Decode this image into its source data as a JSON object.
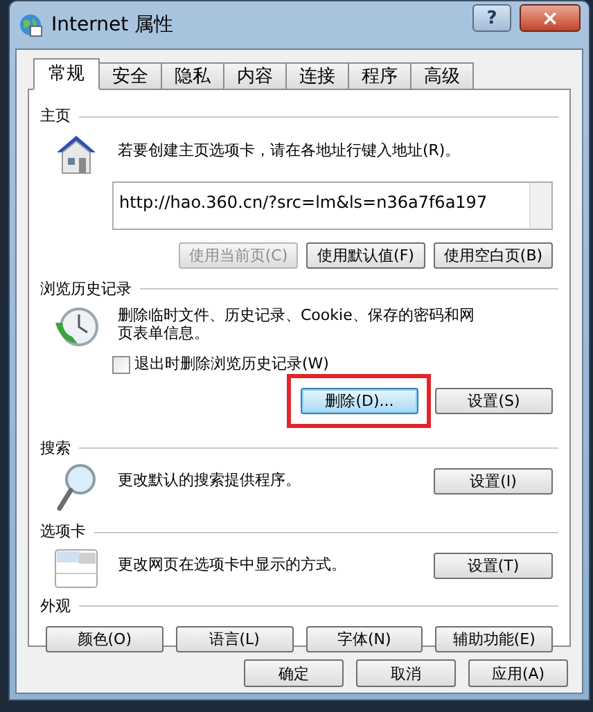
{
  "window": {
    "title": "Internet 属性",
    "help": "?",
    "close": "×"
  },
  "tabs": [
    {
      "label": "常规",
      "selected": true
    },
    {
      "label": "安全",
      "selected": false
    },
    {
      "label": "隐私",
      "selected": false
    },
    {
      "label": "内容",
      "selected": false
    },
    {
      "label": "连接",
      "selected": false
    },
    {
      "label": "程序",
      "selected": false
    },
    {
      "label": "高级",
      "selected": false
    }
  ],
  "home": {
    "heading": "主页",
    "text": "若要创建主页选项卡，请在各地址行键入地址(R)。",
    "url": "http://hao.360.cn/?src=lm&ls=n36a7f6a197",
    "buttons": [
      {
        "label": "使用当前页(C)",
        "disabled": true
      },
      {
        "label": "使用默认值(F)",
        "disabled": false
      },
      {
        "label": "使用空白页(B)",
        "disabled": false
      }
    ]
  },
  "history": {
    "heading": "浏览历史记录",
    "text": "删除临时文件、历史记录、Cookie、保存的密码和网页表单信息。",
    "checkbox": {
      "label": "退出时删除浏览历史记录(W)",
      "checked": false
    },
    "buttons": [
      {
        "label": "删除(D)...",
        "focused": true
      },
      {
        "label": "设置(S)",
        "focused": false
      }
    ]
  },
  "search": {
    "heading": "搜索",
    "text": "更改默认的搜索提供程序。",
    "button": "设置(I)"
  },
  "tabs_section": {
    "heading": "选项卡",
    "text": "更改网页在选项卡中显示的方式。",
    "button": "设置(T)"
  },
  "appearance": {
    "heading": "外观",
    "buttons": [
      "颜色(O)",
      "语言(L)",
      "字体(N)",
      "辅助功能(E)"
    ]
  },
  "footer": {
    "buttons": [
      "确定",
      "取消",
      "应用(A)"
    ]
  }
}
